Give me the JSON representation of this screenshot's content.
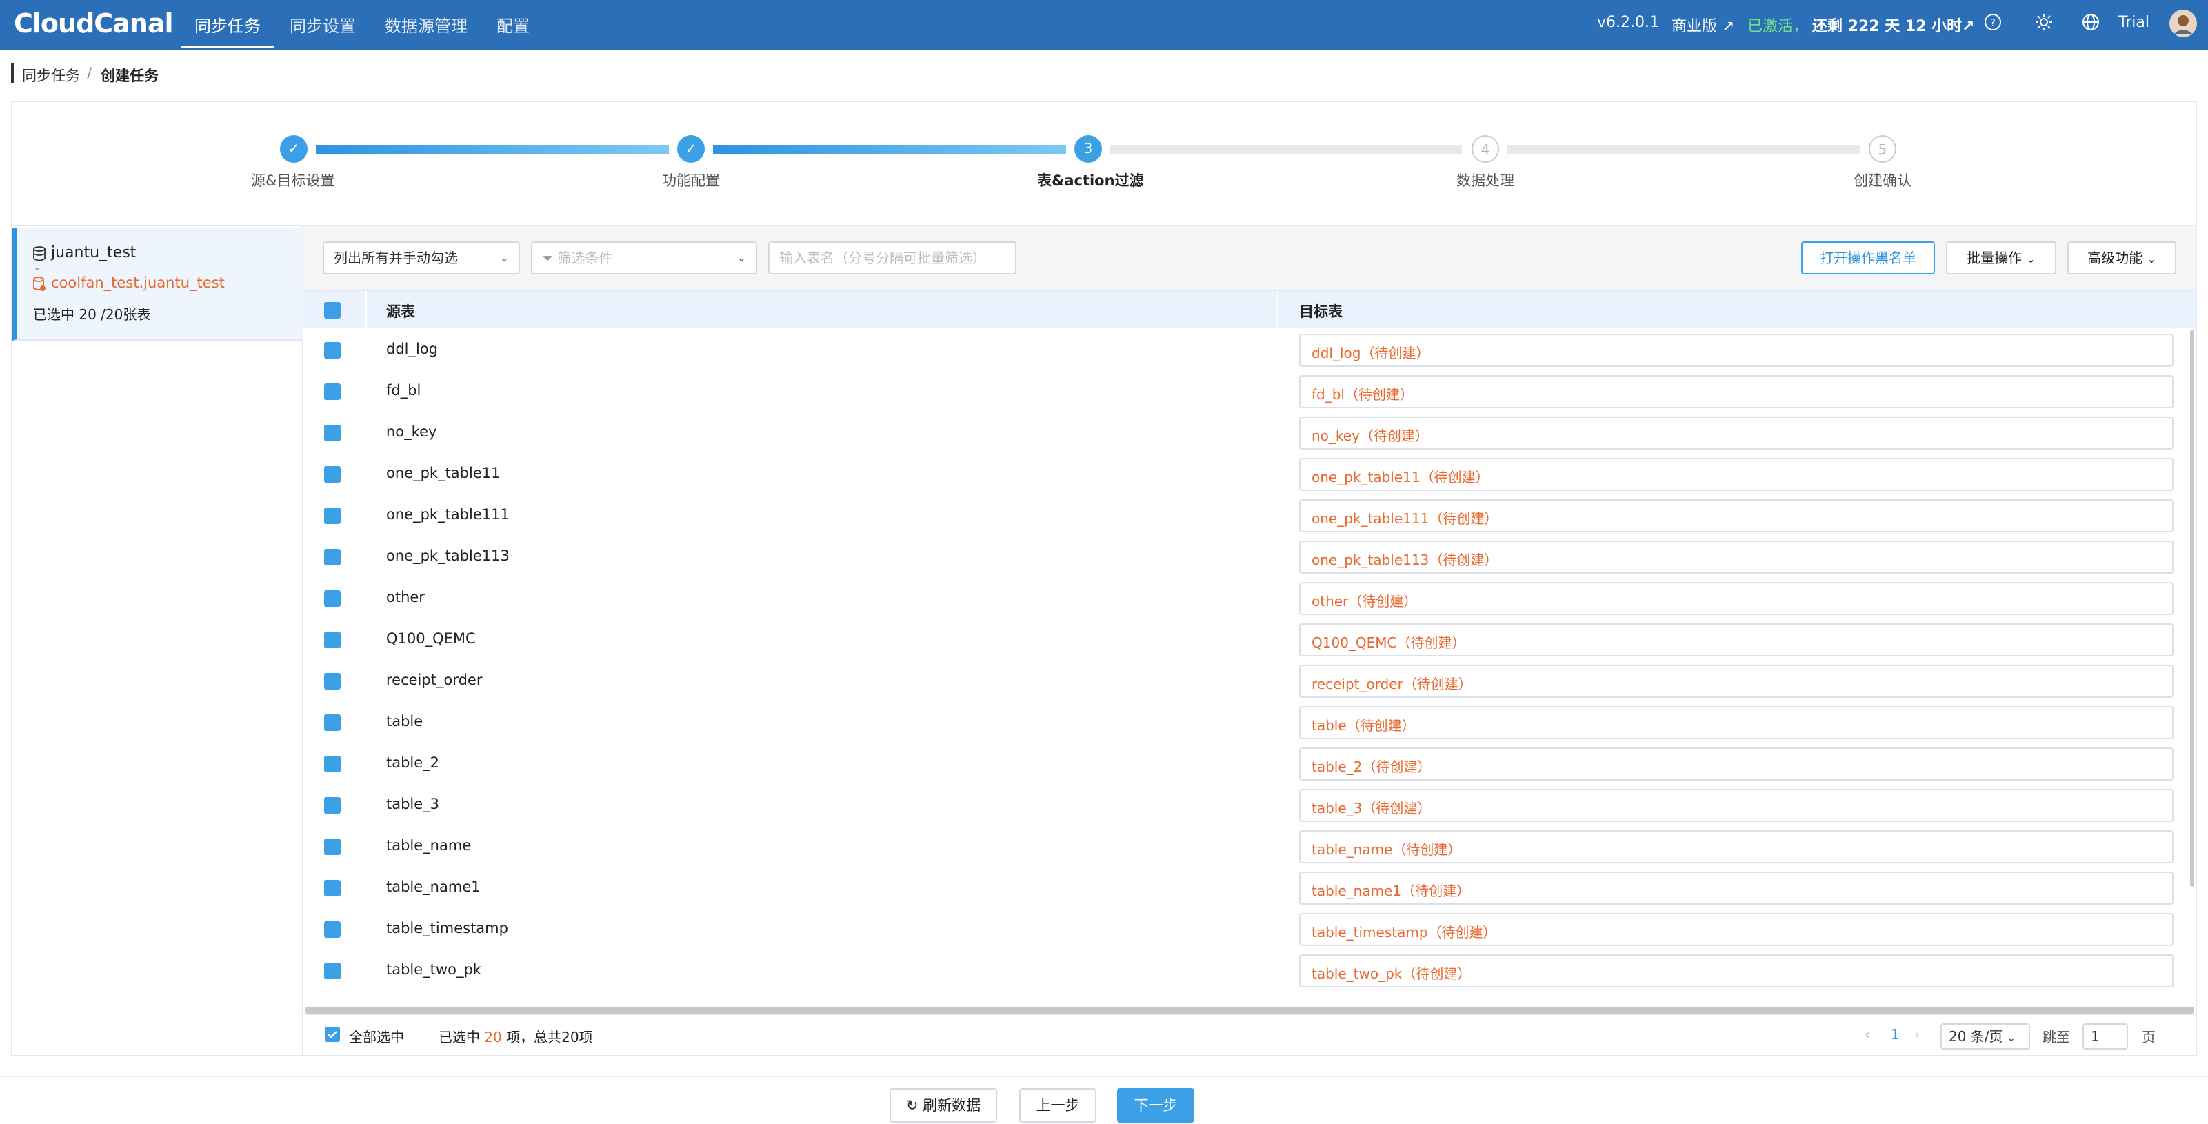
{
  "nav": {
    "logo": "CloudCanal",
    "items": [
      "同步任务",
      "同步设置",
      "数据源管理",
      "配置"
    ],
    "version": "v6.2.0.1",
    "edition": "商业版 ↗",
    "activated": "已激活，",
    "remaining": "还剩 222 天 12 小时↗",
    "user": "Trial"
  },
  "breadcrumb": {
    "parent": "同步任务",
    "separator": "/",
    "current": "创建任务"
  },
  "steps": [
    {
      "num": "✓",
      "label": "源&目标设置",
      "state": "done"
    },
    {
      "num": "✓",
      "label": "功能配置",
      "state": "done"
    },
    {
      "num": "3",
      "label": "表&action过滤",
      "state": "current"
    },
    {
      "num": "4",
      "label": "数据处理",
      "state": "todo"
    },
    {
      "num": "5",
      "label": "创建确认",
      "state": "todo"
    }
  ],
  "left": {
    "db_name": "juantu_test",
    "db_target": "coolfan_test.juantu_test",
    "selected": "已选中 20 /20张表"
  },
  "toolbar": {
    "mode": "列出所有并手动勾选",
    "filter_placeholder": "筛选条件",
    "search_placeholder": "输入表名（分号分隔可批量筛选）",
    "blacklist": "打开操作黑名单",
    "batch": "批量操作",
    "advanced": "高级功能"
  },
  "table": {
    "col_source": "源表",
    "col_target": "目标表",
    "rows": [
      {
        "src": "ddl_log",
        "tgt": "ddl_log（待创建）"
      },
      {
        "src": "fd_bl",
        "tgt": "fd_bl（待创建）"
      },
      {
        "src": "no_key",
        "tgt": "no_key（待创建）"
      },
      {
        "src": "one_pk_table11",
        "tgt": "one_pk_table11（待创建）"
      },
      {
        "src": "one_pk_table111",
        "tgt": "one_pk_table111（待创建）"
      },
      {
        "src": "one_pk_table113",
        "tgt": "one_pk_table113（待创建）"
      },
      {
        "src": "other",
        "tgt": "other（待创建）"
      },
      {
        "src": "Q100_QEMC",
        "tgt": "Q100_QEMC（待创建）"
      },
      {
        "src": "receipt_order",
        "tgt": "receipt_order（待创建）"
      },
      {
        "src": "table",
        "tgt": "table（待创建）"
      },
      {
        "src": "table_2",
        "tgt": "table_2（待创建）"
      },
      {
        "src": "table_3",
        "tgt": "table_3（待创建）"
      },
      {
        "src": "table_name",
        "tgt": "table_name（待创建）"
      },
      {
        "src": "table_name1",
        "tgt": "table_name1（待创建）"
      },
      {
        "src": "table_timestamp",
        "tgt": "table_timestamp（待创建）"
      },
      {
        "src": "table_two_pk",
        "tgt": "table_two_pk（待创建）"
      }
    ]
  },
  "footer": {
    "select_all": "全部选中",
    "selected_prefix": "已选中",
    "selected_count": "20",
    "selected_suffix": "项，总共20项",
    "page": "1",
    "page_size": "20 条/页",
    "jump_label": "跳至",
    "jump_value": "1",
    "page_unit": "页"
  },
  "actions": {
    "refresh": "刷新数据",
    "prev": "上一步",
    "next": "下一步"
  },
  "colors": {
    "brand": "#2a6fb7",
    "accent": "#3ba0e6",
    "warn": "#e8692e"
  }
}
